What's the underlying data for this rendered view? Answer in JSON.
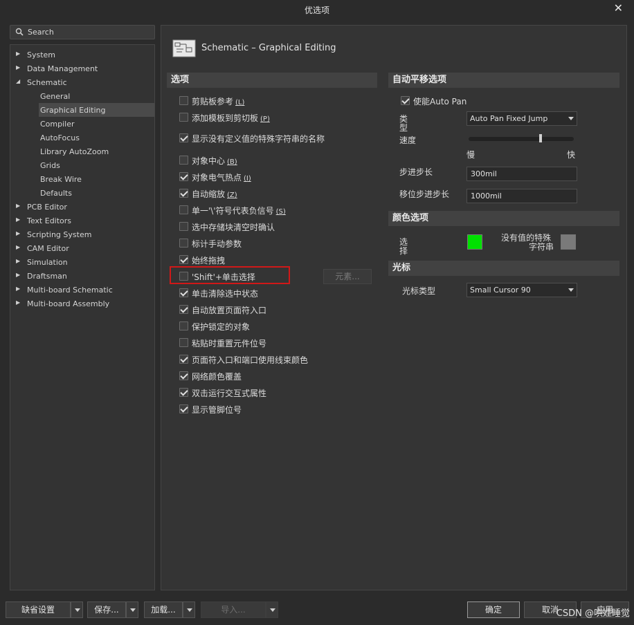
{
  "window": {
    "title": "优选项",
    "close_glyph": "✕"
  },
  "search": {
    "placeholder": "Search"
  },
  "sidebar": {
    "items": [
      {
        "label": "System",
        "level": 0,
        "expanded": false
      },
      {
        "label": "Data Management",
        "level": 0,
        "expanded": false
      },
      {
        "label": "Schematic",
        "level": 0,
        "expanded": true
      },
      {
        "label": "General",
        "level": 1
      },
      {
        "label": "Graphical Editing",
        "level": 1,
        "selected": true
      },
      {
        "label": "Compiler",
        "level": 1
      },
      {
        "label": "AutoFocus",
        "level": 1
      },
      {
        "label": "Library AutoZoom",
        "level": 1
      },
      {
        "label": "Grids",
        "level": 1
      },
      {
        "label": "Break Wire",
        "level": 1
      },
      {
        "label": "Defaults",
        "level": 1
      },
      {
        "label": "PCB Editor",
        "level": 0,
        "expanded": false
      },
      {
        "label": "Text Editors",
        "level": 0,
        "expanded": false
      },
      {
        "label": "Scripting System",
        "level": 0,
        "expanded": false
      },
      {
        "label": "CAM Editor",
        "level": 0,
        "expanded": false
      },
      {
        "label": "Simulation",
        "level": 0,
        "expanded": false
      },
      {
        "label": "Draftsman",
        "level": 0,
        "expanded": false
      },
      {
        "label": "Multi-board Schematic",
        "level": 0,
        "expanded": false
      },
      {
        "label": "Multi-board Assembly",
        "level": 0,
        "expanded": false
      }
    ]
  },
  "page": {
    "title": "Schematic – Graphical Editing"
  },
  "options": {
    "header": "选项",
    "items": [
      {
        "label": "剪贴板参考",
        "shortcut": "L",
        "checked": false
      },
      {
        "label": "添加模板到剪切板",
        "shortcut": "P",
        "checked": false
      },
      {
        "label": "显示没有定义值的特殊字符串的名称",
        "shortcut": "",
        "checked": true
      },
      {
        "label": "对象中心",
        "shortcut": "B",
        "checked": false
      },
      {
        "label": "对象电气热点",
        "shortcut": "I",
        "checked": true
      },
      {
        "label": "自动缩放",
        "shortcut": "Z",
        "checked": true
      },
      {
        "label": "单一'\\'符号代表负信号",
        "shortcut": "S",
        "checked": false
      },
      {
        "label": "选中存储块清空时确认",
        "shortcut": "",
        "checked": false
      },
      {
        "label": "标计手动参数",
        "shortcut": "",
        "checked": false
      },
      {
        "label": "始终拖拽",
        "shortcut": "",
        "checked": true
      },
      {
        "label": "'Shift'+单击选择",
        "shortcut": "",
        "checked": false
      },
      {
        "label": "单击清除选中状态",
        "shortcut": "",
        "checked": true
      },
      {
        "label": "自动放置页面符入口",
        "shortcut": "",
        "checked": true
      },
      {
        "label": "保护锁定的对象",
        "shortcut": "",
        "checked": false
      },
      {
        "label": "粘贴时重置元件位号",
        "shortcut": "",
        "checked": false
      },
      {
        "label": "页面符入口和端口使用线束颜色",
        "shortcut": "",
        "checked": true
      },
      {
        "label": "网络颜色覆盖",
        "shortcut": "",
        "checked": true
      },
      {
        "label": "双击运行交互式属性",
        "shortcut": "",
        "checked": true
      },
      {
        "label": "显示管脚位号",
        "shortcut": "",
        "checked": true
      }
    ],
    "elements_button": "元素..."
  },
  "autopan": {
    "header": "自动平移选项",
    "enable_label": "使能Auto Pan",
    "enable_checked": true,
    "type_label_1": "类",
    "type_label_2": "型",
    "type_value": "Auto Pan Fixed Jump",
    "speed_label": "速度",
    "speed_slow": "慢",
    "speed_fast": "快",
    "speed_level": 0.7,
    "step_label": "步进步长",
    "step_value": "300mil",
    "shift_step_label": "移位步进步长",
    "shift_step_value": "1000mil"
  },
  "colors": {
    "header": "颜色选项",
    "select_label_1": "选",
    "select_label_2": "择",
    "selection_color": "#00e000",
    "no_value_label_1": "没有值的特殊",
    "no_value_label_2": "字符串",
    "no_value_color": "#7a7a7a"
  },
  "cursor": {
    "header": "光标",
    "type_label": "光标类型",
    "type_value": "Small Cursor 90"
  },
  "footer": {
    "defaults": "缺省设置",
    "save": "保存...",
    "load": "加载...",
    "import": "导入...",
    "ok": "确定",
    "cancel": "取消",
    "apply": "应用",
    "watermark": "CSDN @哄娃睡觉"
  }
}
